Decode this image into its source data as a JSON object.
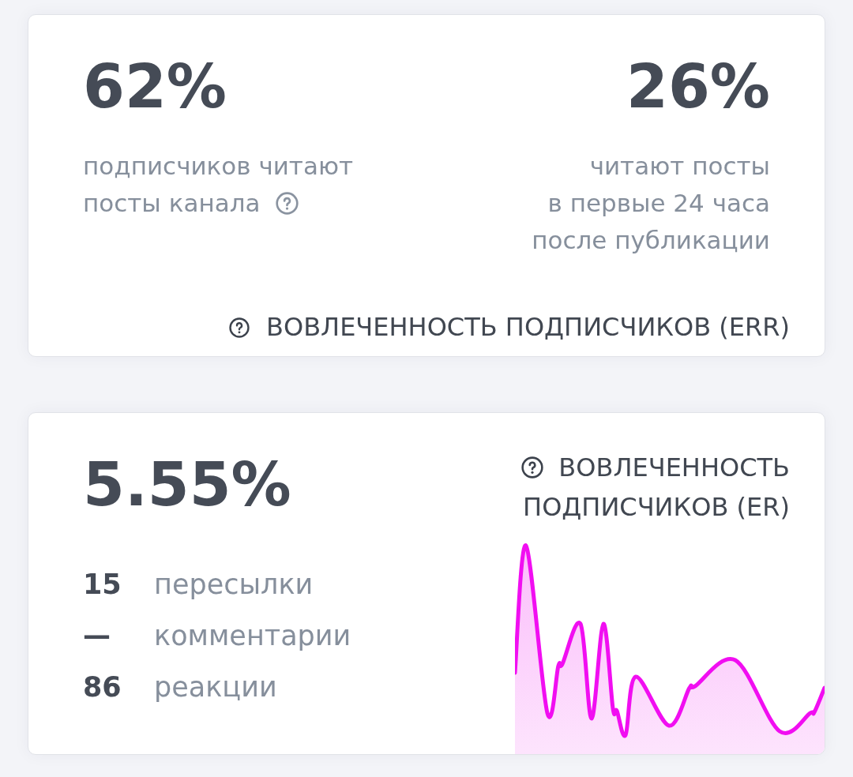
{
  "err_card": {
    "metrics": [
      {
        "value": "62%",
        "caption_lines": [
          "подписчиков читают",
          "посты канала"
        ],
        "help_icon": true
      },
      {
        "value": "26%",
        "caption_lines": [
          "читают посты",
          "в первые 24 часа",
          "после публикации"
        ],
        "help_icon": false
      }
    ],
    "title": "ВОВЛЕЧЕННОСТЬ ПОДПИСЧИКОВ (ERR)"
  },
  "er_card": {
    "value": "5.55%",
    "title_lines": [
      "ВОВЛЕЧЕННОСТЬ",
      "ПОДПИСЧИКОВ (ER)"
    ],
    "stats": [
      {
        "count": "15",
        "label": "пересылки"
      },
      {
        "count": "—",
        "label": "комментарии"
      },
      {
        "count": "86",
        "label": "реакции"
      }
    ]
  }
}
